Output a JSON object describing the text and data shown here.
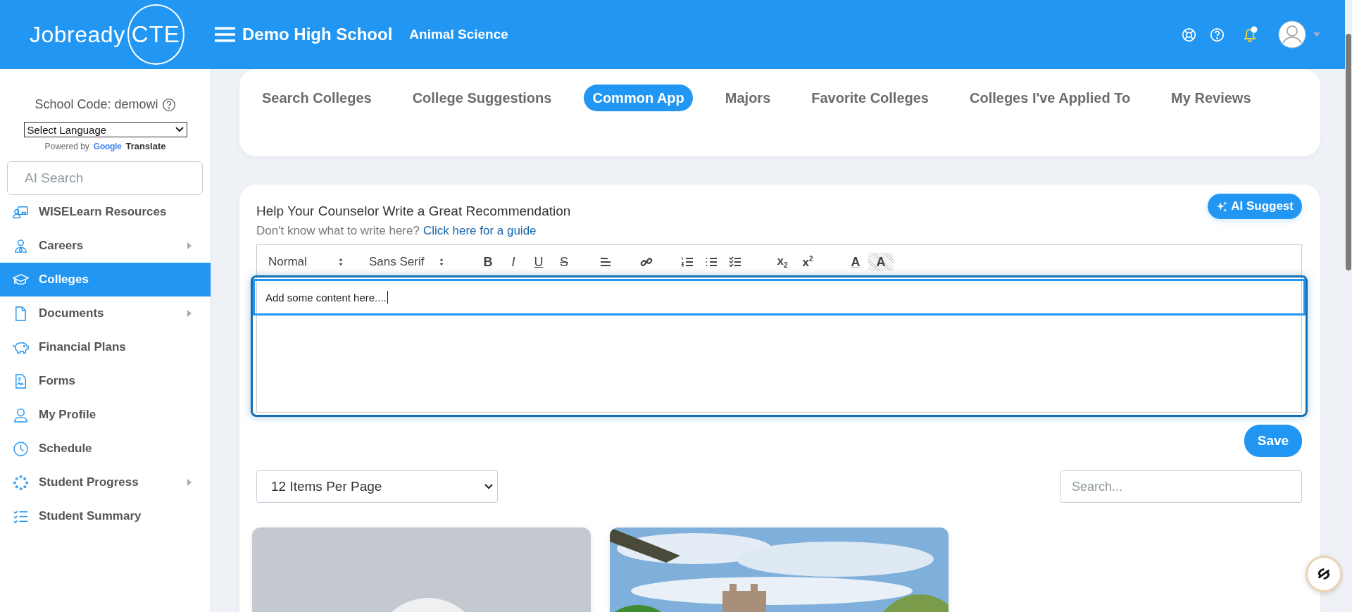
{
  "header": {
    "logo_word": "Jobready",
    "logo_badge": "CTE",
    "school": "Demo High School",
    "program": "Animal Science",
    "notification_unread": true
  },
  "sidebar": {
    "school_code": "School Code: demowi",
    "language_select": "Select Language",
    "powered_by": "Powered by",
    "google": "Google",
    "translate": "Translate",
    "search_placeholder": "AI Search",
    "items": [
      {
        "label": "WISELearn Resources",
        "selected": false,
        "has_submenu": false
      },
      {
        "label": "Careers",
        "selected": false,
        "has_submenu": true
      },
      {
        "label": "Colleges",
        "selected": true,
        "has_submenu": false
      },
      {
        "label": "Documents",
        "selected": false,
        "has_submenu": true
      },
      {
        "label": "Financial Plans",
        "selected": false,
        "has_submenu": false
      },
      {
        "label": "Forms",
        "selected": false,
        "has_submenu": false
      },
      {
        "label": "My Profile",
        "selected": false,
        "has_submenu": false
      },
      {
        "label": "Schedule",
        "selected": false,
        "has_submenu": false
      },
      {
        "label": "Student Progress",
        "selected": false,
        "has_submenu": true
      },
      {
        "label": "Student Summary",
        "selected": false,
        "has_submenu": false
      }
    ]
  },
  "tabs": [
    {
      "label": "Search Colleges",
      "selected": false
    },
    {
      "label": "College Suggestions",
      "selected": false
    },
    {
      "label": "Common App",
      "selected": true
    },
    {
      "label": "Majors",
      "selected": false
    },
    {
      "label": "Favorite Colleges",
      "selected": false
    },
    {
      "label": "Colleges I've Applied To",
      "selected": false
    },
    {
      "label": "My Reviews",
      "selected": false
    }
  ],
  "recommendation": {
    "title": "Help Your Counselor Write a Great Recommendation",
    "prompt": "Don't know what to write here?",
    "guide_link": "Click here for a guide",
    "ai_button": "AI Suggest",
    "toolbar": [
      {
        "kind": "select",
        "label": "Normal"
      },
      {
        "kind": "select",
        "label": "Sans Serif"
      },
      {
        "kind": "bold",
        "label": "B"
      },
      {
        "kind": "italic",
        "label": "I"
      },
      {
        "kind": "underline",
        "label": "U"
      },
      {
        "kind": "strike",
        "label": "S"
      },
      {
        "kind": "align"
      },
      {
        "kind": "link"
      },
      {
        "kind": "ordered-list"
      },
      {
        "kind": "bullet-list"
      },
      {
        "kind": "check-list"
      },
      {
        "kind": "subscript",
        "label": "x",
        "index": "2"
      },
      {
        "kind": "superscript",
        "label": "x",
        "index": "2"
      },
      {
        "kind": "color",
        "label": "A"
      },
      {
        "kind": "background",
        "label": "A"
      }
    ],
    "content": "Add some content here....",
    "focused": true,
    "save": "Save"
  },
  "listing": {
    "page_size": "12 Items Per Page",
    "search_placeholder": "Search...",
    "cards": [
      {
        "kind": "placeholder"
      },
      {
        "kind": "picture"
      }
    ]
  }
}
